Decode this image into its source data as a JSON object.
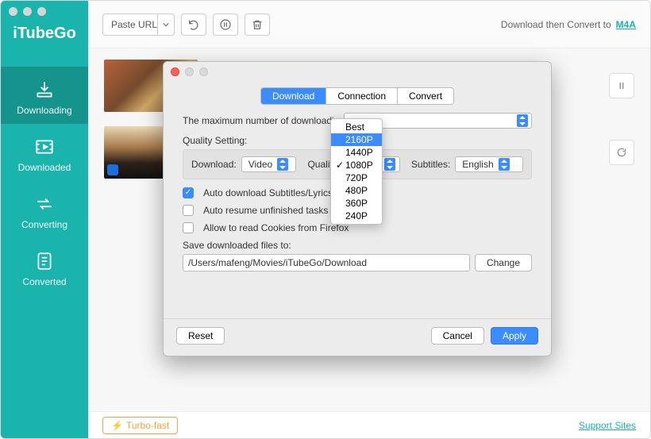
{
  "app_title": "iTubeGo",
  "sidebar": {
    "items": [
      {
        "label": "Downloading"
      },
      {
        "label": "Downloaded"
      },
      {
        "label": "Converting"
      },
      {
        "label": "Converted"
      }
    ]
  },
  "toolbar": {
    "paste_url_label": "Paste URL",
    "convert_label": "Download then Convert to",
    "convert_format": "M4A"
  },
  "footer": {
    "turbo_label": "Turbo-fast",
    "support_link": "Support Sites"
  },
  "modal": {
    "tabs": [
      "Download",
      "Connection",
      "Convert"
    ],
    "active_tab": 0,
    "max_downloads_label": "The maximum number of downloadin",
    "max_downloads_value": "",
    "quality_section_label": "Quality Setting:",
    "download_label": "Download:",
    "download_value": "Video",
    "quality_label": "Quality:",
    "quality_value": "1080P",
    "subtitles_label": "Subtitles:",
    "subtitles_value": "English",
    "cb_auto_subtitles": "Auto download Subtitles/Lyrics",
    "cb_auto_resume": "Auto resume unfinished tasks on startup",
    "cb_cookies": "Allow to read Cookies from Firefox",
    "save_to_label": "Save downloaded files to:",
    "save_to_path": "/Users/mafeng/Movies/iTubeGo/Download",
    "change_label": "Change",
    "reset_label": "Reset",
    "cancel_label": "Cancel",
    "apply_label": "Apply"
  },
  "quality_options": [
    "Best",
    "2160P",
    "1440P",
    "1080P",
    "720P",
    "480P",
    "360P",
    "240P"
  ],
  "quality_selected_index": 1,
  "quality_checked_index": 3
}
